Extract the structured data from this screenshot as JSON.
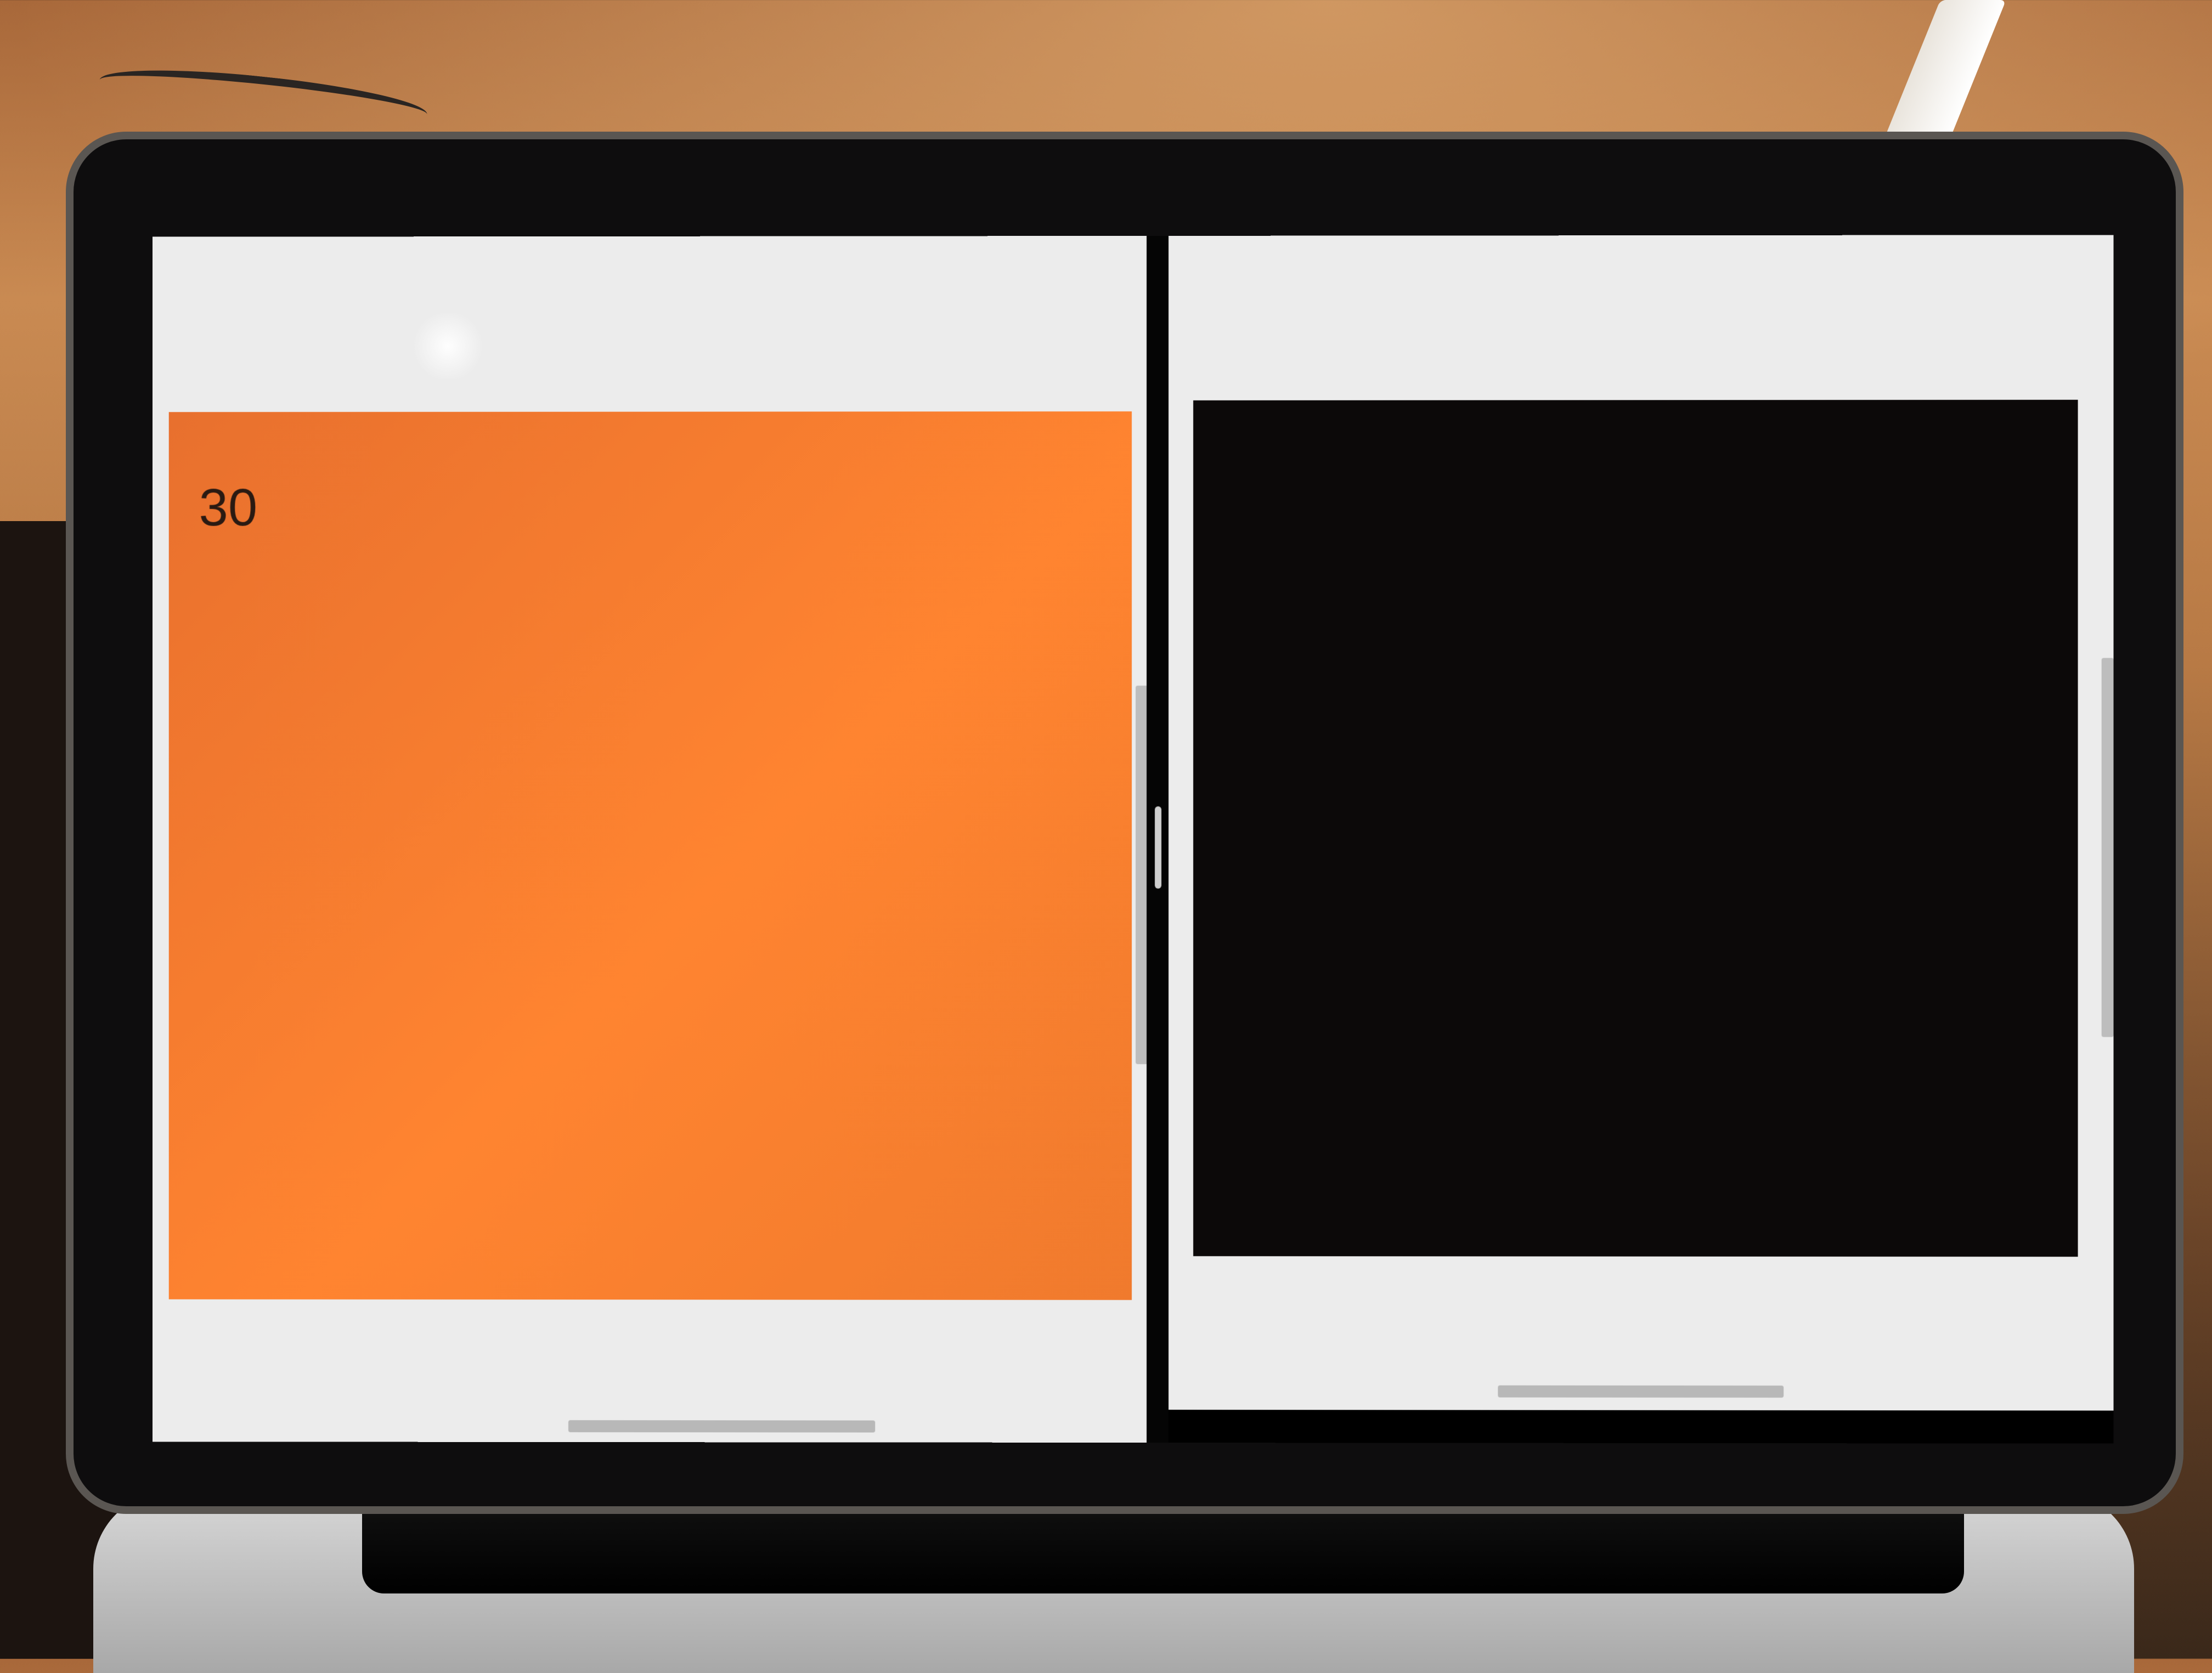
{
  "colors": {
    "pane_background": "#ececec",
    "left_block": "#ff8430",
    "right_block": "#0c0909",
    "divider": "#050505"
  },
  "left_pane": {
    "block_number": "30"
  },
  "right_pane": {}
}
